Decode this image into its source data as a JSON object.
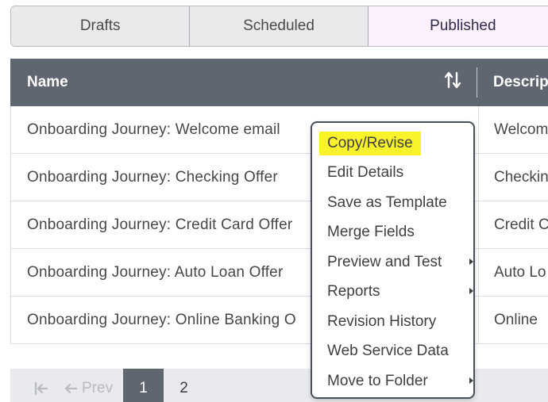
{
  "tabs": [
    {
      "label": "Drafts"
    },
    {
      "label": "Scheduled"
    },
    {
      "label": "Published",
      "active": true
    }
  ],
  "table": {
    "headers": {
      "name": "Name",
      "description": "Descrip"
    },
    "rows": [
      {
        "name": "Onboarding Journey: Welcome email",
        "description": "Welcom"
      },
      {
        "name": "Onboarding Journey: Checking Offer",
        "description": "Checkin"
      },
      {
        "name": "Onboarding Journey: Credit Card Offer",
        "description": "Credit C"
      },
      {
        "name": "Onboarding Journey: Auto Loan Offer",
        "description": "Auto Lo"
      },
      {
        "name": "Onboarding Journey: Online Banking O",
        "description": "Online"
      }
    ]
  },
  "pagination": {
    "prev_label": "Prev",
    "pages": [
      "1",
      "2"
    ],
    "current_page": "1"
  },
  "context_menu": {
    "items": [
      {
        "label": "Copy/Revise",
        "highlighted": true
      },
      {
        "label": "Edit Details"
      },
      {
        "label": "Save as Template"
      },
      {
        "label": "Merge Fields"
      },
      {
        "label": "Preview and Test",
        "submenu": true
      },
      {
        "label": "Reports",
        "submenu": true
      },
      {
        "label": "Revision History"
      },
      {
        "label": "Web Service Data"
      },
      {
        "label": "Move to Folder",
        "submenu": true
      }
    ]
  },
  "colors": {
    "header_bg": "#5f6670",
    "active_tab_bg": "#fbf0fb",
    "highlight": "#faf32c"
  },
  "icons": {
    "sort": "sort-arrows-icon",
    "first_page": "first-page-icon",
    "prev_page": "arrow-left-icon",
    "submenu": "chevron-right-icon"
  }
}
